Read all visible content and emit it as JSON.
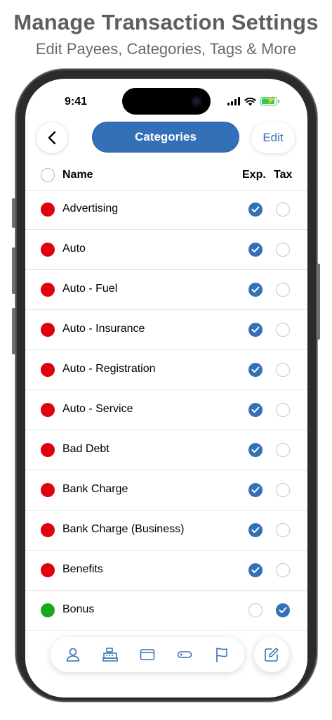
{
  "banner": {
    "title": "Manage Transaction Settings",
    "subtitle": "Edit Payees, Categories, Tags & More"
  },
  "status_bar": {
    "time": "9:41"
  },
  "nav": {
    "title": "Categories",
    "edit_label": "Edit"
  },
  "table": {
    "headers": {
      "name": "Name",
      "expense": "Exp.",
      "tax": "Tax"
    },
    "rows": [
      {
        "name": "Advertising",
        "color": "#e0000e",
        "exp": true,
        "tax": false
      },
      {
        "name": "Auto",
        "color": "#e0000e",
        "exp": true,
        "tax": false
      },
      {
        "name": "Auto - Fuel",
        "color": "#e0000e",
        "exp": true,
        "tax": false
      },
      {
        "name": "Auto - Insurance",
        "color": "#e0000e",
        "exp": true,
        "tax": false
      },
      {
        "name": "Auto - Registration",
        "color": "#e0000e",
        "exp": true,
        "tax": false
      },
      {
        "name": "Auto - Service",
        "color": "#e0000e",
        "exp": true,
        "tax": false
      },
      {
        "name": "Bad Debt",
        "color": "#e0000e",
        "exp": true,
        "tax": false
      },
      {
        "name": "Bank Charge",
        "color": "#e0000e",
        "exp": true,
        "tax": false
      },
      {
        "name": "Bank Charge (Business)",
        "color": "#e0000e",
        "exp": true,
        "tax": false
      },
      {
        "name": "Benefits",
        "color": "#e0000e",
        "exp": true,
        "tax": false
      },
      {
        "name": "Bonus",
        "color": "#17a81c",
        "exp": false,
        "tax": true
      }
    ]
  },
  "colors": {
    "accent": "#3470b8",
    "expense": "#e0000e",
    "income": "#17a81c"
  },
  "tab_bar": {
    "icons": [
      "person-icon",
      "cash-register-icon",
      "wallet-icon",
      "tag-icon",
      "flag-icon"
    ],
    "compose_icon": "compose-icon"
  }
}
